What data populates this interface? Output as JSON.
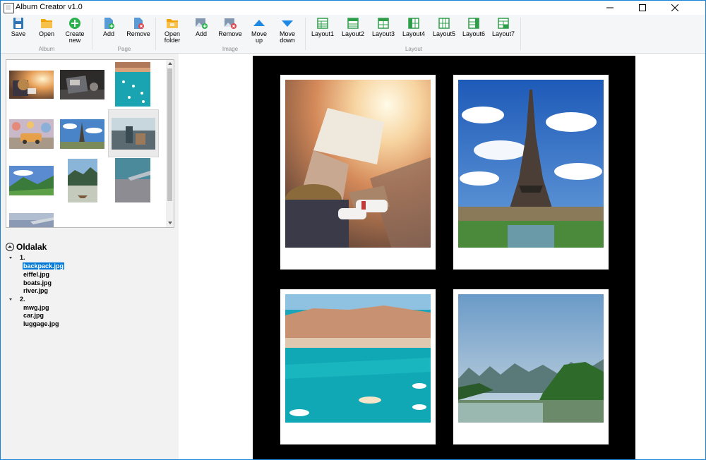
{
  "window": {
    "title": "Album Creator v1.0"
  },
  "ribbon": {
    "groups": {
      "album": "Album",
      "page": "Page",
      "image": "Image",
      "layout": "Layout"
    },
    "buttons": {
      "save": "Save",
      "open": "Open",
      "create_new": "Create\nnew",
      "page_add": "Add",
      "page_remove": "Remove",
      "open_folder": "Open\nfolder",
      "image_add": "Add",
      "image_remove": "Remove",
      "move_up": "Move\nup",
      "move_down": "Move\ndown",
      "layout1": "Layout1",
      "layout2": "Layout2",
      "layout3": "Layout3",
      "layout4": "Layout4",
      "layout5": "Layout5",
      "layout6": "Layout6",
      "layout7": "Layout7"
    }
  },
  "tree": {
    "root": "Oldalak",
    "pages": [
      {
        "label": "1.",
        "files": [
          "backpack.jpg",
          "eiffel.jpg",
          "boats.jpg",
          "river.jpg"
        ]
      },
      {
        "label": "2.",
        "files": [
          "mwg.jpg",
          "car.jpg",
          "luggage.jpg"
        ]
      }
    ],
    "selected_file": "backpack.jpg"
  },
  "colors": {
    "accent": "#0078d7",
    "page_background": "#000000",
    "selection": "#0078d7"
  }
}
